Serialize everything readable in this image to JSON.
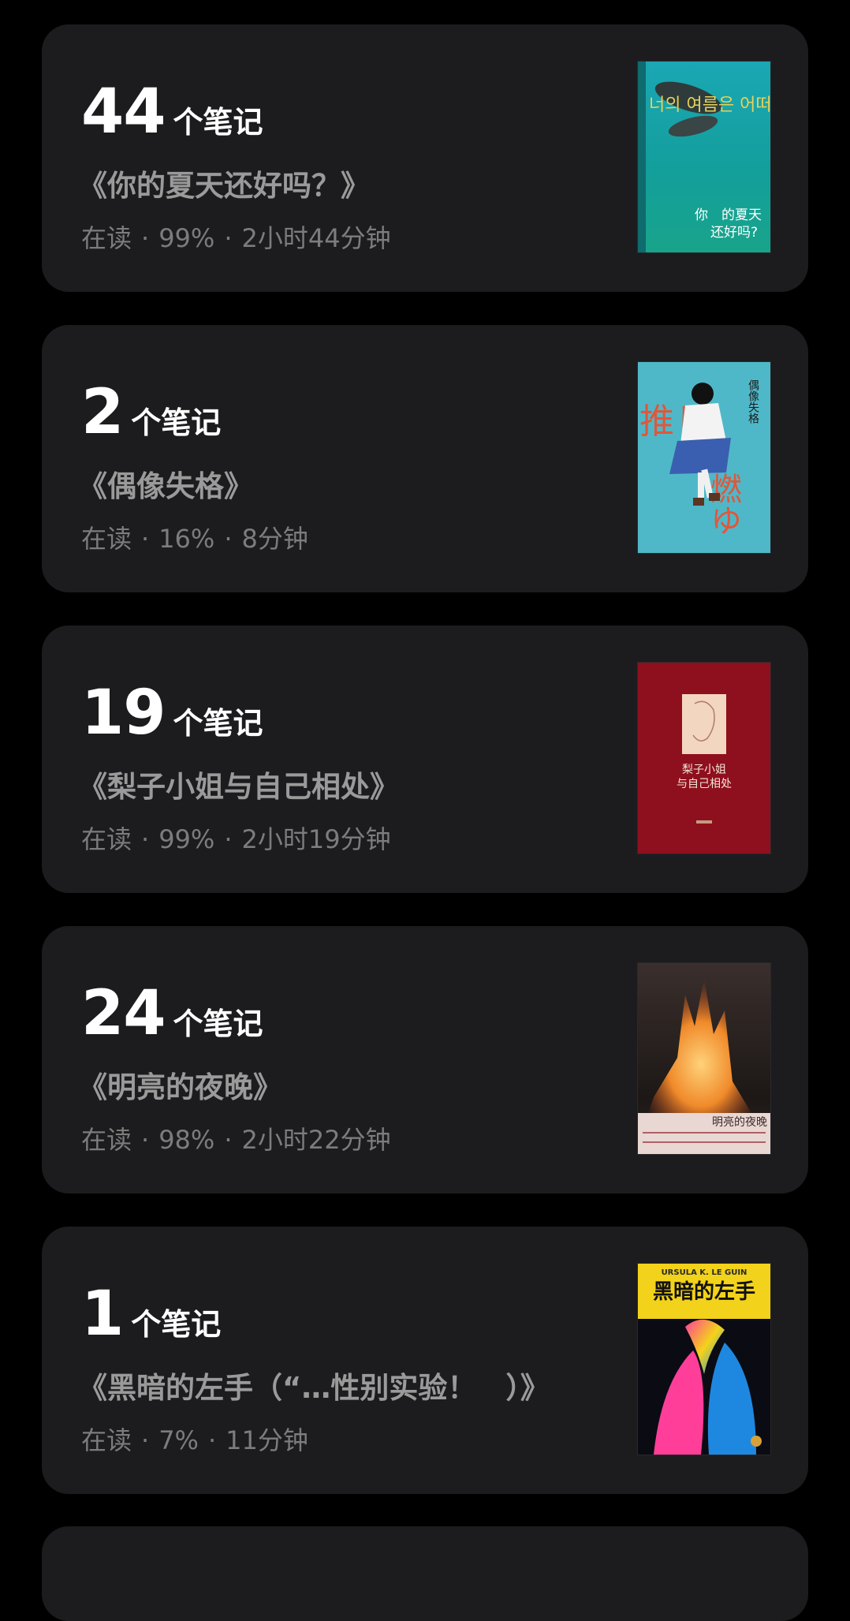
{
  "notes": [
    {
      "count": "44",
      "unit": "个笔记",
      "title": "《你的夏天还好吗？》",
      "status": "在读",
      "progress": "99%",
      "duration": "2小时44分钟",
      "cover": {
        "top_text": "너의 여름은 어떠니",
        "title_cn_1": "你　的夏天",
        "title_cn_2": "还好吗?",
        "color": "#1aa8a6"
      }
    },
    {
      "count": "2",
      "unit": "个笔记",
      "title": "《偶像失格》",
      "status": "在读",
      "progress": "16%",
      "duration": "8分钟",
      "cover": {
        "title_cn": "偶像失格",
        "big_left": "推し",
        "big_right": "燃ゆ",
        "color": "#4fb8c8"
      }
    },
    {
      "count": "19",
      "unit": "个笔记",
      "title": "《梨子小姐与自己相处》",
      "status": "在读",
      "progress": "99%",
      "duration": "2小时19分钟",
      "cover": {
        "title_line_1": "梨子小姐",
        "title_line_2": "与自己相处",
        "color": "#8e0f1e"
      }
    },
    {
      "count": "24",
      "unit": "个笔记",
      "title": "《明亮的夜晚》",
      "status": "在读",
      "progress": "98%",
      "duration": "2小时22分钟",
      "cover": {
        "title_cn": "明亮的夜晚",
        "color": "#2a2422"
      }
    },
    {
      "count": "1",
      "unit": "个笔记",
      "title": "《黑暗的左手（“…性别实验！　）》",
      "status": "在读",
      "progress": "7%",
      "duration": "11分钟",
      "cover": {
        "author": "URSULA K. LE GUIN",
        "title_cn": "黑暗的左手",
        "color": "#f2d21a"
      }
    }
  ]
}
